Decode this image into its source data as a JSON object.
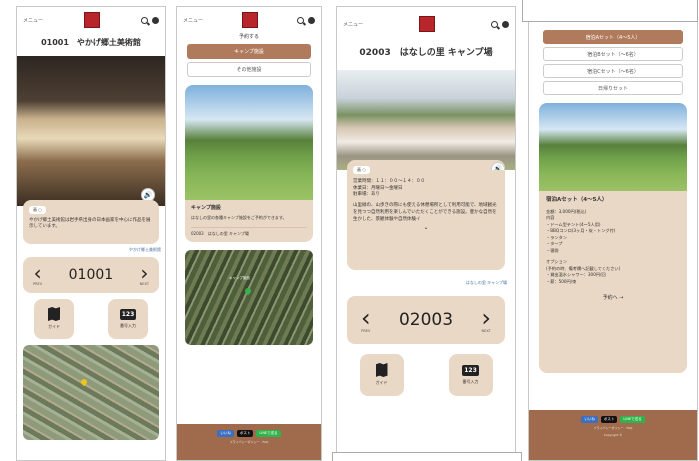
{
  "header": {
    "menu_label": "メニュー"
  },
  "screen1": {
    "title": "01001　やかげ郷土美術館",
    "tag": "画 ○",
    "description": "やかげ郷土美術館は岩手県出身の日本画家を中心に作品を展示しています。",
    "link": "やかげ郷土美術館",
    "prev_label": "PREV",
    "code": "01001",
    "next_label": "NEXT",
    "guide_label": "ガイド",
    "number_label": "番号入力",
    "num_icon_text": "123"
  },
  "screen2": {
    "tab_active": "キャンプ施設",
    "tab_other": "その他施設",
    "facility_title": "キャンプ施設",
    "facility_text": "はなしの里の各種キャンプ施設をご予約ができます。",
    "facility_footer": "02003　はなしの里 キャンプ場",
    "map_pin_label": "キャンプ施設",
    "top_label": "予約する",
    "share": {
      "fb": "いいね",
      "x": "ポスト",
      "line": "LINEで送る"
    },
    "footer_text": "プライバシーポリシー　FAQ"
  },
  "screen3": {
    "title": "02003　はなしの里 キャンプ場",
    "tag": "画 ○",
    "info": [
      "営業時間：１１：００～１４：００",
      "休業日：月曜日～金曜日",
      "駐車場：あり"
    ],
    "description": "山里緑の、山歩きの際にも使える休憩場所として利用可能で、地域観光を見つつ自然利用を楽しんでいただくことができる施設。豊かな自然を生かした、景観体験や自然体験イ",
    "link": "はなしの里 キャンプ場",
    "prev_label": "PREV",
    "code": "02003",
    "next_label": "NEXT",
    "guide_label": "ガイド",
    "number_label": "番号入力",
    "num_icon_text": "123"
  },
  "screen4": {
    "sets": [
      "宿泊Aセット（4～5人）",
      "宿泊Bセット（～6名）",
      "宿泊Cセット（～6名）",
      "日帰りセット"
    ],
    "plan_title": "宿泊Aセット（4～5人）",
    "plan_lines": [
      "金額：3,000円(税込)",
      "内容",
      "・ドーム型テント(4～5人用)",
      "・BBQコンロ(3ヶ月・炭・トング付)",
      "・ランタン",
      "・タープ",
      "・寝袋"
    ],
    "options_title": "オプション",
    "option_lines": [
      "(予約の時、備考欄へ記載してください)",
      "・貸出温水シャワー：300円/回",
      "・薪：500円/束"
    ],
    "reserve_label": "予約へ →",
    "share": {
      "fb": "いいね",
      "x": "ポスト",
      "line": "LINEで送る"
    },
    "footer_text": "プライバシーポリシー　FAQ",
    "copyright": "Copyright ©"
  }
}
